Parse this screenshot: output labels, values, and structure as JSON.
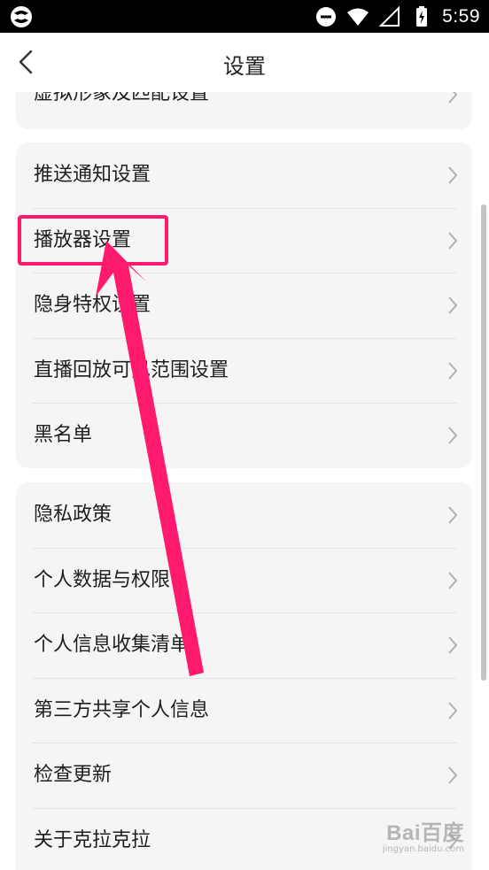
{
  "status_bar": {
    "time": "5:59",
    "icons": [
      "app-logo-icon",
      "do-not-disturb-icon",
      "wifi-icon",
      "signal-icon",
      "battery-charging-icon"
    ]
  },
  "header": {
    "title": "设置",
    "back_icon": "chevron-left-icon"
  },
  "groups": [
    {
      "items": [
        {
          "label": "虚拟形象及匹配设置"
        }
      ]
    },
    {
      "items": [
        {
          "label": "推送通知设置"
        },
        {
          "label": "播放器设置"
        },
        {
          "label": "隐身特权设置"
        },
        {
          "label": "直播回放可见范围设置"
        },
        {
          "label": "黑名单"
        }
      ]
    },
    {
      "items": [
        {
          "label": "隐私政策"
        },
        {
          "label": "个人数据与权限"
        },
        {
          "label": "个人信息收集清单"
        },
        {
          "label": "第三方共享个人信息"
        },
        {
          "label": "检查更新"
        },
        {
          "label": "关于克拉克拉"
        }
      ]
    }
  ],
  "annotation": {
    "highlight_color": "#ff1a6e",
    "highlighted_item": "播放器设置"
  },
  "watermark": {
    "main": "Bai百度",
    "sub": "jingyan.baidu.com"
  },
  "colors": {
    "card_bg": "#f5f5f5",
    "divider": "#e4e4e4",
    "text": "#1e1e1e",
    "chevron": "#b0b0b0"
  }
}
